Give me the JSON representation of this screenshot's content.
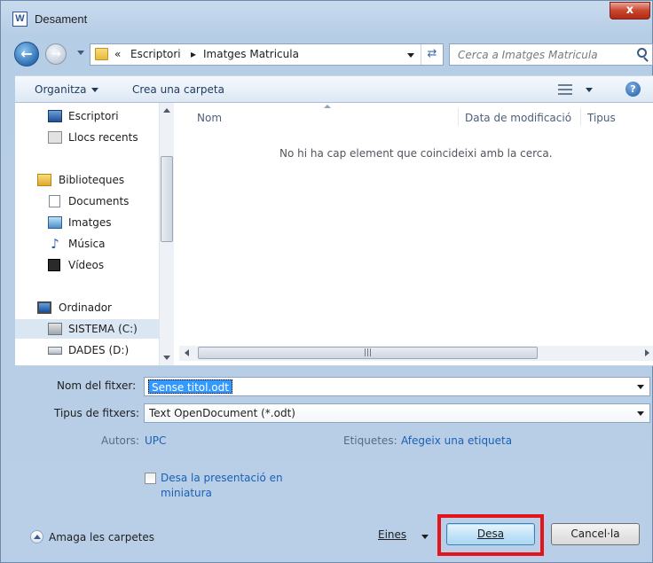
{
  "window": {
    "title": "Desament",
    "app_icon": "W",
    "close_glyph": "x"
  },
  "address": {
    "prefix": "«",
    "crumbs": [
      "Escriptori",
      "Imatges Matricula"
    ],
    "separator": "▸",
    "search_placeholder": "Cerca a Imatges Matricula"
  },
  "toolbar": {
    "organize": "Organitza",
    "new_folder": "Crea una carpeta"
  },
  "nav": {
    "items": [
      {
        "label": "Escriptori",
        "icon": "desktop-icon"
      },
      {
        "label": "Llocs recents",
        "icon": "recent-places-icon"
      },
      {
        "label": "Biblioteques",
        "icon": "libraries-icon"
      },
      {
        "label": "Documents",
        "icon": "documents-icon"
      },
      {
        "label": "Imatges",
        "icon": "images-icon"
      },
      {
        "label": "Música",
        "icon": "music-icon"
      },
      {
        "label": "Vídeos",
        "icon": "videos-icon"
      },
      {
        "label": "Ordinador",
        "icon": "computer-icon"
      },
      {
        "label": "SISTEMA (C:)",
        "icon": "drive-c-icon",
        "selected": true
      },
      {
        "label": "DADES (D:)",
        "icon": "drive-d-icon"
      }
    ]
  },
  "files": {
    "columns": [
      "Nom",
      "Data de modificació",
      "Tipus"
    ],
    "empty_message": "No hi ha cap element que coincideixi amb la cerca."
  },
  "form": {
    "filename_label": "Nom del fitxer:",
    "filename_value": "Sense titol.odt",
    "filetype_label": "Tipus de fitxers:",
    "filetype_value": "Text OpenDocument (*.odt)",
    "authors_label": "Autors:",
    "authors_value": "UPC",
    "tags_label": "Etiquetes:",
    "tags_value": "Afegeix una etiqueta",
    "thumbnail_label": "Desa la presentació en miniatura",
    "thumbnail_checked": false
  },
  "footer": {
    "hide_folders": "Amaga les carpetes",
    "tools": "Eines",
    "save": "Desa",
    "cancel": "Cancel·la"
  },
  "colors": {
    "highlight": "#e3141b",
    "link": "#1a5fb4",
    "selection": "#3399ff"
  }
}
